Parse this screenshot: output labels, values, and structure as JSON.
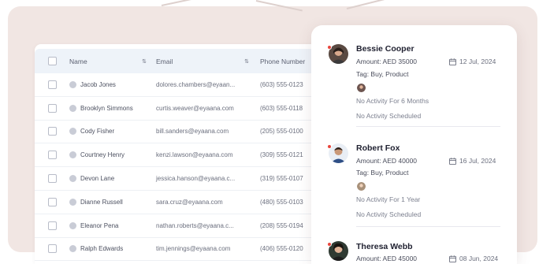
{
  "table": {
    "headers": {
      "name": "Name",
      "email": "Email",
      "phone": "Phone Number"
    },
    "rows": [
      {
        "name": "Jacob Jones",
        "email": "dolores.chambers@eyaan...",
        "phone": "(603) 555-0123"
      },
      {
        "name": "Brooklyn Simmons",
        "email": "curtis.weaver@eyaana.com",
        "phone": "(603) 555-0118"
      },
      {
        "name": "Cody Fisher",
        "email": "bill.sanders@eyaana.com",
        "phone": "(205) 555-0100"
      },
      {
        "name": "Courtney Henry",
        "email": "kenzi.lawson@eyaana.com",
        "phone": "(309) 555-0121"
      },
      {
        "name": "Devon Lane",
        "email": "jessica.hanson@eyaana.c...",
        "phone": "(319) 555-0107"
      },
      {
        "name": "Dianne Russell",
        "email": "sara.cruz@eyaana.com",
        "phone": "(480) 555-0103"
      },
      {
        "name": "Eleanor Pena",
        "email": "nathan.roberts@eyaana.c...",
        "phone": "(208) 555-0194"
      },
      {
        "name": "Ralph Edwards",
        "email": "tim.jennings@eyaana.com",
        "phone": "(406) 555-0120"
      }
    ]
  },
  "contacts": [
    {
      "name": "Bessie Cooper",
      "amount": "Amount: AED 35000",
      "date": "12 Jul, 2024",
      "tags": "Tag: Buy, Product",
      "activity": "No Activity For 6 Months",
      "scheduled": "No Activity Scheduled"
    },
    {
      "name": "Robert Fox",
      "amount": "Amount: AED 40000",
      "date": "16 Jul, 2024",
      "tags": "Tag: Buy, Product",
      "activity": "No Activity For 1 Year",
      "scheduled": "No Activity Scheduled"
    },
    {
      "name": "Theresa Webb",
      "amount": "Amount: AED 45000",
      "date": "08 Jun, 2024"
    }
  ],
  "colors": {
    "backdrop": "#f1e6e3",
    "header": "#eef3f9",
    "status_dot": "#e8453c"
  }
}
